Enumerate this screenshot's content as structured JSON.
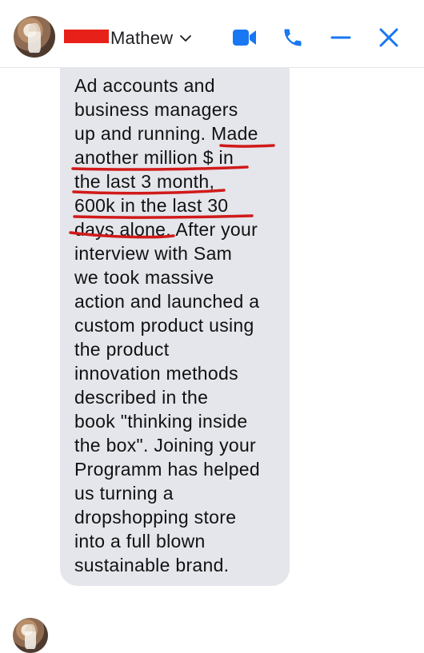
{
  "header": {
    "contact_name": "Mathew",
    "icons": [
      "chevron-down-icon",
      "video-call-icon",
      "phone-call-icon",
      "minimize-icon",
      "close-icon"
    ]
  },
  "colors": {
    "accent": "#1877f2",
    "bubble": "#e4e6eb",
    "highlight_underline": "#d11a1a",
    "redaction": "#e8201a"
  },
  "message": {
    "lines": [
      "Ad accounts and",
      "business managers",
      "up and running. Made",
      "another million $ in",
      "the last 3 month,",
      "600k in the last 30",
      "days alone. After your",
      "interview with Sam",
      "we took massive",
      "action and launched a",
      "custom product using",
      "the product",
      "innovation methods",
      "described in the",
      "book \"thinking inside",
      "the box\". Joining your",
      "Programm has helped",
      "us turning a",
      "dropshopping store",
      "into a full blown",
      "sustainable brand."
    ]
  }
}
